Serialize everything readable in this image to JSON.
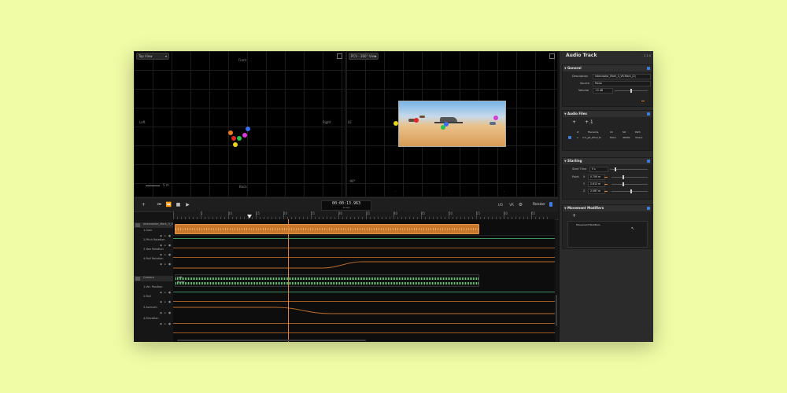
{
  "top_view": {
    "dropdown": "Top View",
    "label_front": "Front",
    "label_back": "Back",
    "label_left": "Left",
    "label_right": "Right",
    "scale": "5 m"
  },
  "pcv_view": {
    "dropdown": "PCV - 360° View",
    "label_left": "LE",
    "label_bottom_left": "-90°"
  },
  "transport": {
    "timecode": "00:00:13.963",
    "timecode_sub": "10 fps",
    "loop_label": "I/O",
    "vr_label": "VR",
    "render_label": "Render"
  },
  "ruler": {
    "labels": [
      "5",
      "10",
      "15",
      "20",
      "25",
      "30",
      "35",
      "40",
      "45",
      "50",
      "55",
      "60",
      "65",
      "70"
    ]
  },
  "tracks": [
    {
      "name": "Interceptor_Mark_3_VR",
      "type": "clip"
    },
    {
      "name": "1.Gain",
      "type": "auto"
    },
    {
      "name": "2.Pitch Rotation",
      "type": "auto"
    },
    {
      "name": "3.Yaw Rotation",
      "type": "auto"
    },
    {
      "name": "4.Roll Rotation",
      "type": "auto"
    },
    {
      "name": "Camera",
      "type": "clip"
    },
    {
      "name": "1.Vel. Position",
      "type": "auto"
    },
    {
      "name": "2.Roll",
      "type": "auto"
    },
    {
      "name": "3.Azimuth",
      "type": "auto"
    },
    {
      "name": "4.Elevation",
      "type": "auto"
    }
  ],
  "clip_channels": {
    "left": "Left",
    "right": "Right"
  },
  "inspector": {
    "title": "Audio Track",
    "version": "2.1.0",
    "general": {
      "title": "General",
      "description_label": "Description",
      "description_value": "Interceptor_Mark_3_VR-Mark_(2)",
      "source_label": "Source",
      "source_value": "Mono",
      "volume_label": "Volume",
      "volume_value": "+0 dB"
    },
    "audio_files": {
      "title": "Audio Files",
      "add": "+",
      "add_multi": "+.1",
      "headers": [
        "#",
        "Filename",
        "Ch",
        "SR",
        "Path"
      ],
      "row": [
        "1",
        "C-S_jet_Wind_fo",
        "Mono",
        "48000",
        "/Users"
      ]
    },
    "starting": {
      "title": "Starting",
      "start_time_label": "Start Time",
      "start_time_value": "0 s",
      "point_label": "Point",
      "x_label": "X",
      "x_value": "0.709 m",
      "y_label": "Y",
      "y_value": "2.612 m",
      "z_label": "Z",
      "z_value": "2.567 m"
    },
    "movement": {
      "title": "Movement Modifiers",
      "add": "+",
      "list_header": "Movement Modifiers"
    }
  },
  "colors": {
    "background": "#f1fca6",
    "accent_orange": "#e0833a",
    "accent_green": "#5ccf7c",
    "info_blue": "#3b7ee0"
  }
}
